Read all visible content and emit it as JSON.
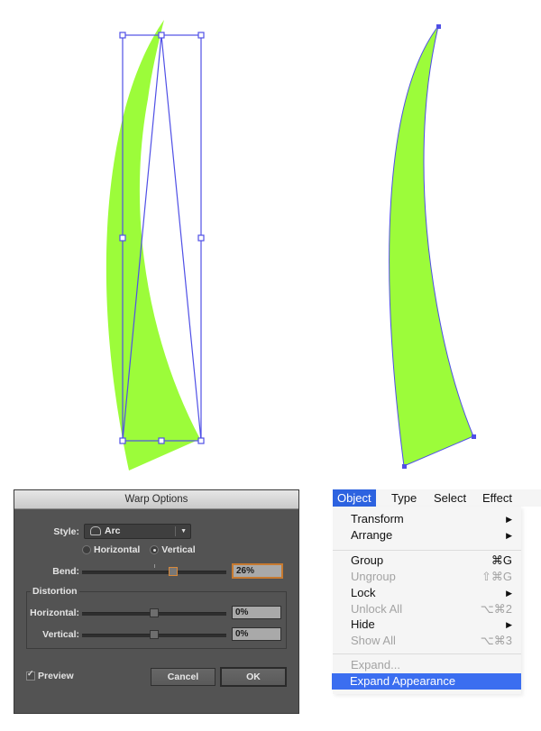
{
  "artwork": {
    "fill_color": "#9cfc3a",
    "selection_color": "#4f4fe6",
    "left_panel": "warp-preview-with-bounding-box",
    "right_panel": "expanded-shape-with-anchor-points"
  },
  "warp_dialog": {
    "title": "Warp Options",
    "style_label": "Style:",
    "style_value": "Arc",
    "style_icon": "arc-warp-icon",
    "orientation_options": [
      "Horizontal",
      "Vertical"
    ],
    "orientation_selected": "Vertical",
    "bend_label": "Bend:",
    "bend_value": "26%",
    "bend_fraction": 0.26,
    "distortion_label": "Distortion",
    "horizontal_label": "Horizontal:",
    "horizontal_value": "0%",
    "vertical_label": "Vertical:",
    "vertical_value": "0%",
    "preview_label": "Preview",
    "preview_checked": true,
    "cancel_label": "Cancel",
    "ok_label": "OK"
  },
  "object_menu": {
    "menubar": [
      "Object",
      "Type",
      "Select",
      "Effect"
    ],
    "active_menu": "Object",
    "items": [
      {
        "label": "Transform",
        "shortcut": "▶",
        "disabled": false
      },
      {
        "label": "Arrange",
        "shortcut": "▶",
        "disabled": false
      },
      {
        "label": "Group",
        "shortcut": "⌘G",
        "disabled": false
      },
      {
        "label": "Ungroup",
        "shortcut": "⇧⌘G",
        "disabled": true
      },
      {
        "label": "Lock",
        "shortcut": "▶",
        "disabled": false
      },
      {
        "label": "Unlock All",
        "shortcut": "⌥⌘2",
        "disabled": true
      },
      {
        "label": "Hide",
        "shortcut": "▶",
        "disabled": false
      },
      {
        "label": "Show All",
        "shortcut": "⌥⌘3",
        "disabled": true
      },
      {
        "label": "Expand...",
        "shortcut": "",
        "disabled": true
      },
      {
        "label": "Expand Appearance",
        "shortcut": "",
        "disabled": false,
        "selected": true
      }
    ]
  }
}
